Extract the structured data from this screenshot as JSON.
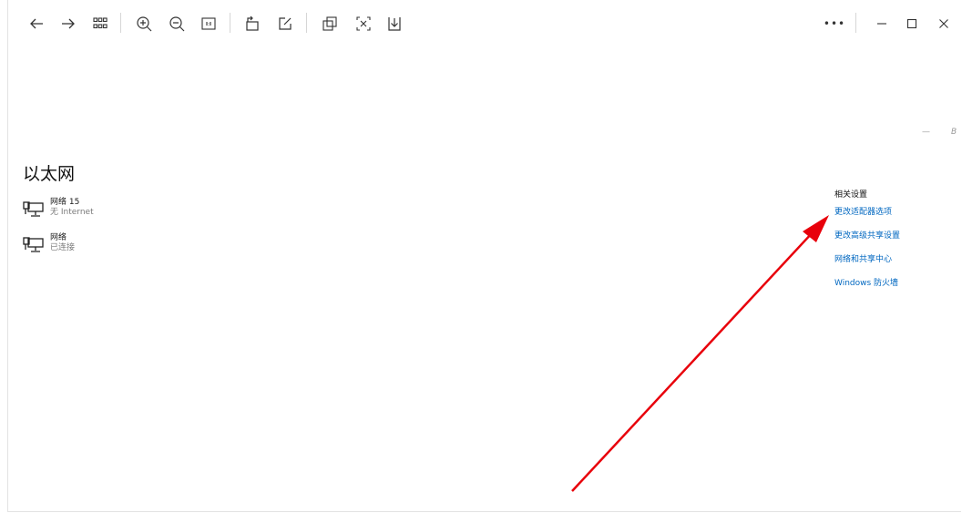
{
  "toolbar": {
    "icons": [
      "back-arrow-icon",
      "forward-arrow-icon",
      "grid-icon",
      "zoom-in-icon",
      "zoom-out-icon",
      "actual-size-icon",
      "rotate-icon",
      "edit-icon",
      "copy-icon",
      "ocr-icon",
      "save-icon"
    ],
    "more_label": "•••"
  },
  "side_hint": {
    "dash": "—",
    "letter": "B"
  },
  "page": {
    "title": "以太网",
    "adapters": [
      {
        "name": "网络 15",
        "status": "无 Internet"
      },
      {
        "name": "网络",
        "status": "已连接"
      }
    ]
  },
  "related": {
    "title": "相关设置",
    "links": [
      "更改适配器选项",
      "更改高级共享设置",
      "网络和共享中心",
      "Windows 防火墙"
    ]
  },
  "annotation": {
    "arrow_color": "#e8000b"
  }
}
